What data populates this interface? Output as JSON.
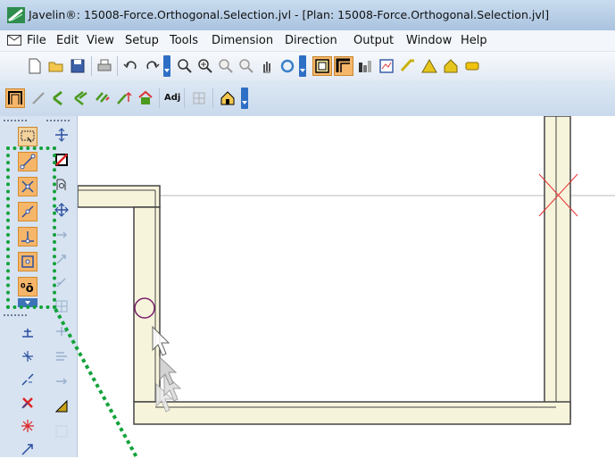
{
  "window": {
    "title": "Javelin®: 15008-Force.Orthogonal.Selection.jvl - [Plan: 15008-Force.Orthogonal.Selection.jvl]"
  },
  "menu": {
    "items": [
      "File",
      "Edit",
      "View",
      "Setup",
      "Tools",
      "Dimension",
      "Direction",
      "Output",
      "Window",
      "Help"
    ]
  },
  "toolbar2": {
    "adj_label": "Adj"
  },
  "colors": {
    "wall_fill": "#f7f4dc",
    "wall_stroke": "#444444",
    "selection_orange": "#f6b66a",
    "annotation_green": "#11a23a",
    "cursor_circle": "#7a1f6e",
    "cross_red": "#e83030"
  },
  "icons": {
    "toolbar1": [
      "new-icon",
      "open-icon",
      "save-icon",
      "print-icon",
      "undo-icon",
      "redo-icon",
      "zoom-window-icon",
      "zoom-in-icon",
      "zoom-out-icon",
      "zoom-extents-icon",
      "pan-icon",
      "refresh-icon",
      "wall-view-icon",
      "window-view-icon",
      "bar-chart-icon",
      "report-icon",
      "roof-icon",
      "warning-icon",
      "house-icon",
      "tag-icon"
    ],
    "toolbar2": [
      "plan-icon",
      "draw-icon",
      "offset-icon",
      "offset2-icon",
      "copy-icon",
      "move-icon",
      "elevation-icon",
      "grid-icon",
      "roof-tool-icon"
    ],
    "palette_left": [
      "select-window-icon",
      "endpoint-snap-icon",
      "intersection-snap-icon",
      "midpoint-snap-icon",
      "perpendicular-snap-icon",
      "center-snap-icon",
      "orthogonal-force-icon",
      "expand-icon",
      "trim-icon",
      "extend-icon",
      "break-icon",
      "delete-icon",
      "cross-icon",
      "arrow-icon"
    ],
    "palette_right": [
      "move-cross-icon",
      "no-select-icon",
      "find-icon",
      "move-arrows-icon",
      "stretch-icon",
      "copy-arrows-icon",
      "align-icon",
      "split-icon",
      "join-icon",
      "arrow-right-icon",
      "ruler-icon",
      "mirror-icon"
    ]
  }
}
